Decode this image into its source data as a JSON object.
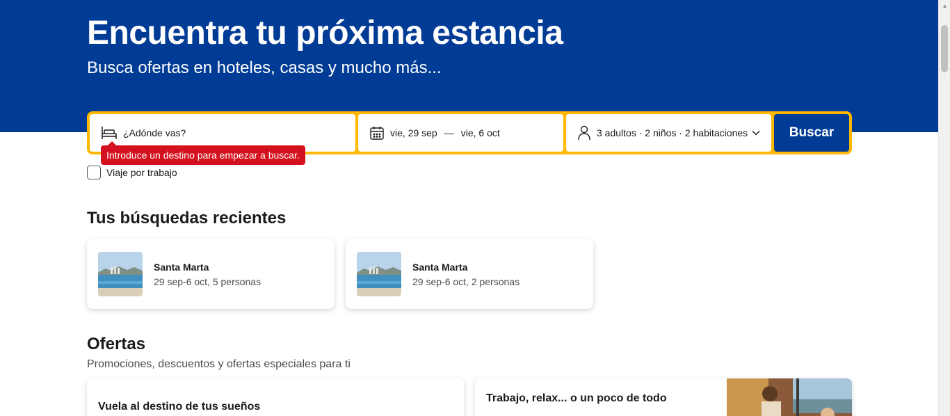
{
  "hero": {
    "title": "Encuentra tu próxima estancia",
    "subtitle": "Busca ofertas en hoteles, casas y mucho más..."
  },
  "search": {
    "destination_placeholder": "¿Adónde vas?",
    "destination_icon": "bed-icon",
    "date_icon": "calendar-icon",
    "checkin": "vie, 29 sep",
    "date_separator": "—",
    "checkout": "vie, 6 oct",
    "guests_icon": "person-icon",
    "guests": "3 adultos · 2 niños · 2 habitaciones",
    "button_label": "Buscar",
    "error": "Introduce un destino para empezar a buscar.",
    "colors": {
      "border": "#ffb700",
      "button": "#003b95",
      "error": "#d4111e"
    }
  },
  "work_trip": {
    "label": "Viaje por trabajo",
    "checked": false
  },
  "recent": {
    "title": "Tus búsquedas recientes",
    "items": [
      {
        "name": "Santa Marta",
        "detail": "29 sep-6 oct, 5 personas"
      },
      {
        "name": "Santa Marta",
        "detail": "29 sep-6 oct, 2 personas"
      }
    ]
  },
  "offers": {
    "title": "Ofertas",
    "subtitle": "Promociones, descuentos y ofertas especiales para ti",
    "cards": [
      {
        "title": "Vuela al destino de tus sueños"
      },
      {
        "title": "Trabajo, relax... o un poco de todo"
      }
    ]
  },
  "colors": {
    "brand": "#003b95"
  }
}
